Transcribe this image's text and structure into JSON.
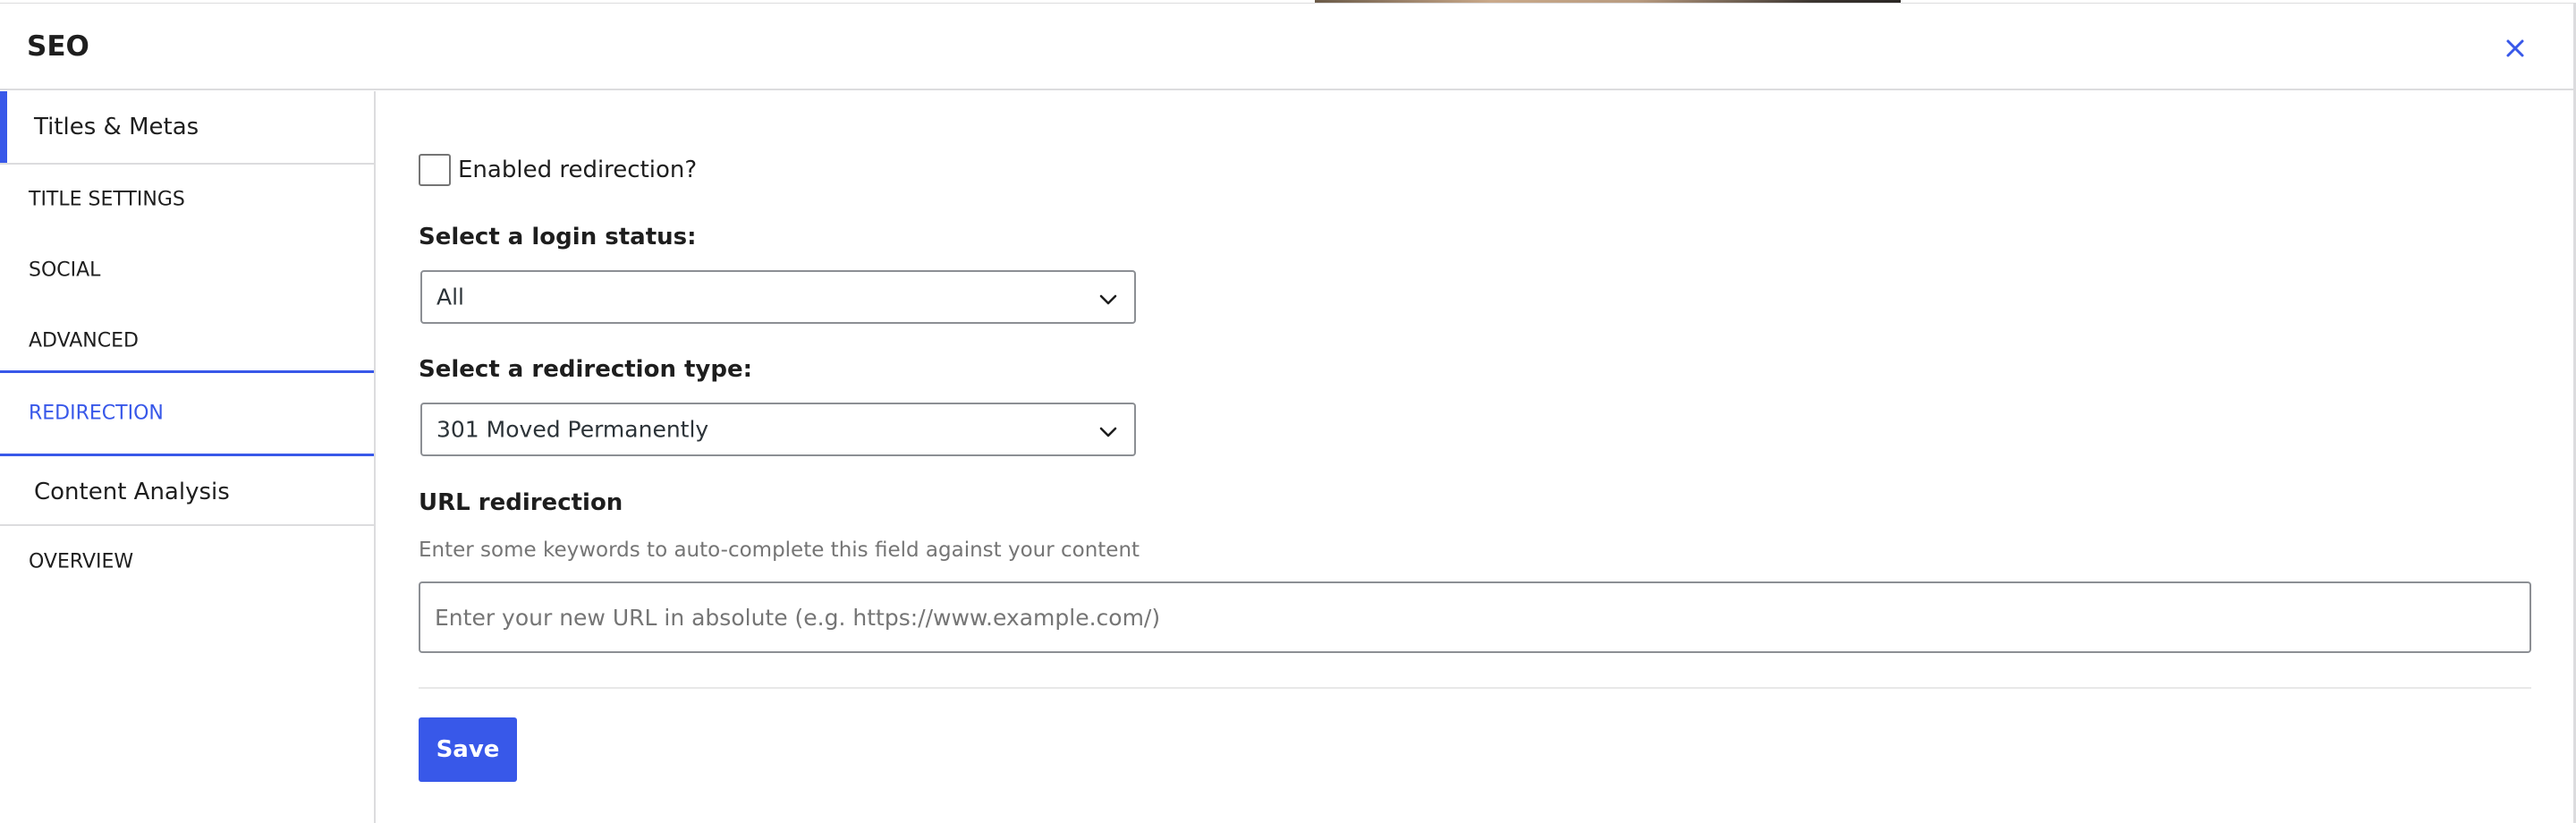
{
  "header": {
    "title": "SEO",
    "close_icon": "close-icon"
  },
  "sidebar": {
    "groups": [
      {
        "label": "Titles & Metas"
      },
      {
        "label": "Content Analysis"
      }
    ],
    "items": [
      {
        "label": "TITLE SETTINGS"
      },
      {
        "label": "SOCIAL"
      },
      {
        "label": "ADVANCED"
      },
      {
        "label": "REDIRECTION"
      },
      {
        "label": "OVERVIEW"
      }
    ]
  },
  "form": {
    "enable_redirection_label": "Enabled redirection?",
    "enable_redirection_checked": false,
    "login_status_label": "Select a login status:",
    "login_status_value": "All",
    "redirection_type_label": "Select a redirection type:",
    "redirection_type_value": "301 Moved Permanently",
    "url_label": "URL redirection",
    "url_help": "Enter some keywords to auto-complete this field against your content",
    "url_placeholder": "Enter your new URL in absolute (e.g. https://www.example.com/)",
    "url_value": "",
    "save_label": "Save"
  },
  "colors": {
    "accent": "#3858e9",
    "border": "#dcdcde",
    "muted_text": "#757575"
  }
}
